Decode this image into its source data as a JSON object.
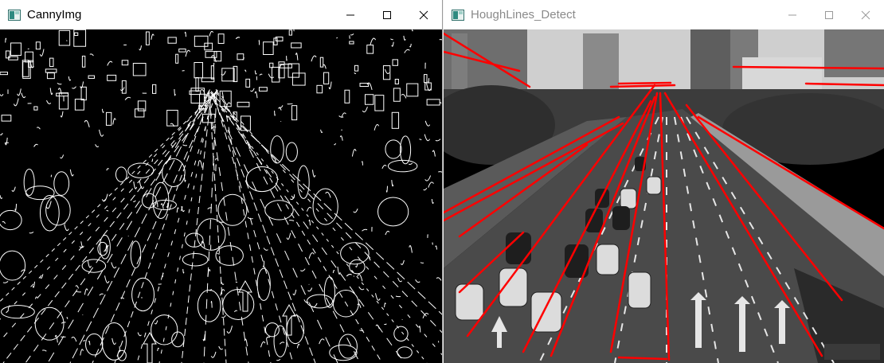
{
  "windows": [
    {
      "title": "CannyImg",
      "icon": "window-app-icon",
      "active": true
    },
    {
      "title": "HoughLines_Detect",
      "icon": "window-app-icon",
      "active": false
    }
  ],
  "controls": {
    "minimize": "minimize-icon",
    "maximize": "maximize-icon",
    "close": "close-icon"
  },
  "images": {
    "canny": {
      "kind": "edge-map",
      "background": "#000000",
      "edges": "#ffffff"
    },
    "hough": {
      "kind": "grayscale-road-with-lines",
      "line_color": "#ff0000"
    }
  }
}
